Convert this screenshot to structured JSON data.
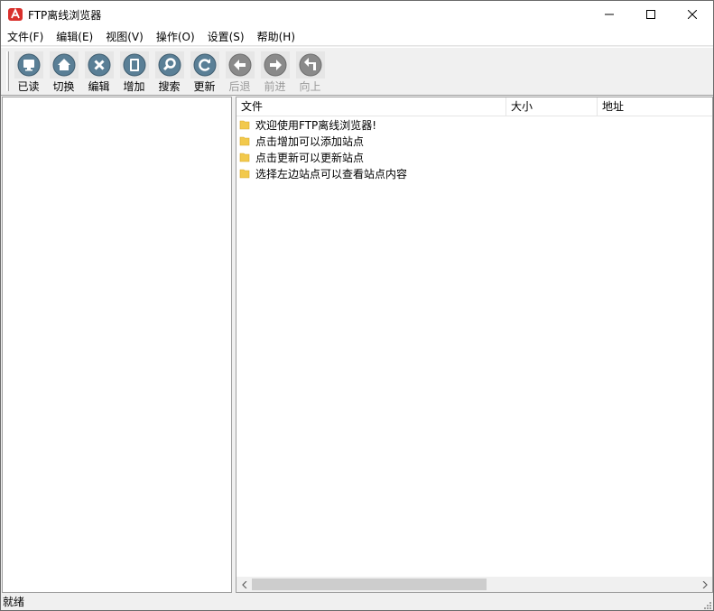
{
  "window": {
    "title": "FTP离线浏览器",
    "controls": {
      "minimize": "—",
      "maximize": "☐",
      "close": "✕"
    }
  },
  "menu": [
    {
      "label": "文件(F)"
    },
    {
      "label": "编辑(E)"
    },
    {
      "label": "视图(V)"
    },
    {
      "label": "操作(O)"
    },
    {
      "label": "设置(S)"
    },
    {
      "label": "帮助(H)"
    }
  ],
  "toolbar": {
    "buttons": [
      {
        "label": "已读",
        "icon": "monitor-icon",
        "enabled": true
      },
      {
        "label": "切换",
        "icon": "home-icon",
        "enabled": true
      },
      {
        "label": "编辑",
        "icon": "close-x-icon",
        "enabled": true
      },
      {
        "label": "增加",
        "icon": "document-icon",
        "enabled": true
      },
      {
        "label": "搜索",
        "icon": "search-icon",
        "enabled": true
      },
      {
        "label": "更新",
        "icon": "refresh-icon",
        "enabled": true
      },
      {
        "label": "后退",
        "icon": "back-arrow-icon",
        "enabled": false
      },
      {
        "label": "前进",
        "icon": "forward-arrow-icon",
        "enabled": false
      },
      {
        "label": "向上",
        "icon": "up-arrow-icon",
        "enabled": false
      }
    ]
  },
  "file_list": {
    "columns": [
      "文件",
      "大小",
      "地址"
    ],
    "rows": [
      {
        "name": "欢迎使用FTP离线浏览器!"
      },
      {
        "name": "点击增加可以添加站点"
      },
      {
        "name": "点击更新可以更新站点"
      },
      {
        "name": "选择左边站点可以查看站点内容"
      }
    ]
  },
  "status": {
    "text": "就绪"
  },
  "colors": {
    "icon_active": "#5a7f96",
    "icon_disabled": "#8a8a8a",
    "folder": "#f2c94c"
  }
}
